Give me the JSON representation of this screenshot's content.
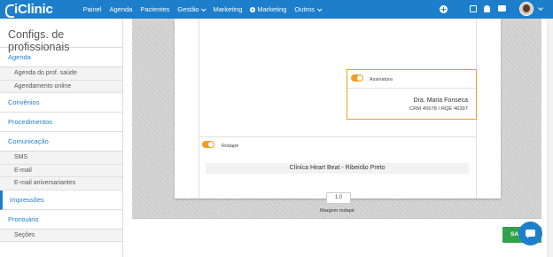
{
  "app": {
    "brand": "iClinic"
  },
  "nav": {
    "items": [
      {
        "label": "Painel"
      },
      {
        "label": "Agenda"
      },
      {
        "label": "Pacientes"
      },
      {
        "label": "Gestão"
      },
      {
        "label": "Marketing"
      },
      {
        "label": "Marketing"
      },
      {
        "label": "Outros"
      }
    ]
  },
  "sidebar": {
    "title": "Configs. de profissionais",
    "sections": [
      {
        "label": "Agenda",
        "subs": [
          "Agenda do prof. saúde",
          "Agendamento online"
        ]
      },
      {
        "label": "Convênios"
      },
      {
        "label": "Procedimentos"
      },
      {
        "label": "Comunicação",
        "subs": [
          "SMS",
          "E-mail",
          "E-mail aniversariantes"
        ]
      },
      {
        "label": "Impressões"
      },
      {
        "label": "Prontuário",
        "subs": [
          "Seções"
        ]
      }
    ]
  },
  "editor": {
    "signature": {
      "label": "Assinatura",
      "name": "Dra. Maria Fonseca",
      "crm": "CRM 45678 / RQE 46397"
    },
    "footer": {
      "label": "Rodapé",
      "text": "Clínica Heart Beat - Ribeirão Preto"
    },
    "margin": {
      "value": "1.0",
      "label": "Margem rodapé"
    }
  },
  "actions": {
    "save_label": "SAL"
  },
  "colors": {
    "brand": "#1d7fcb",
    "toggle": "#f0a020",
    "save": "#31a24c"
  }
}
